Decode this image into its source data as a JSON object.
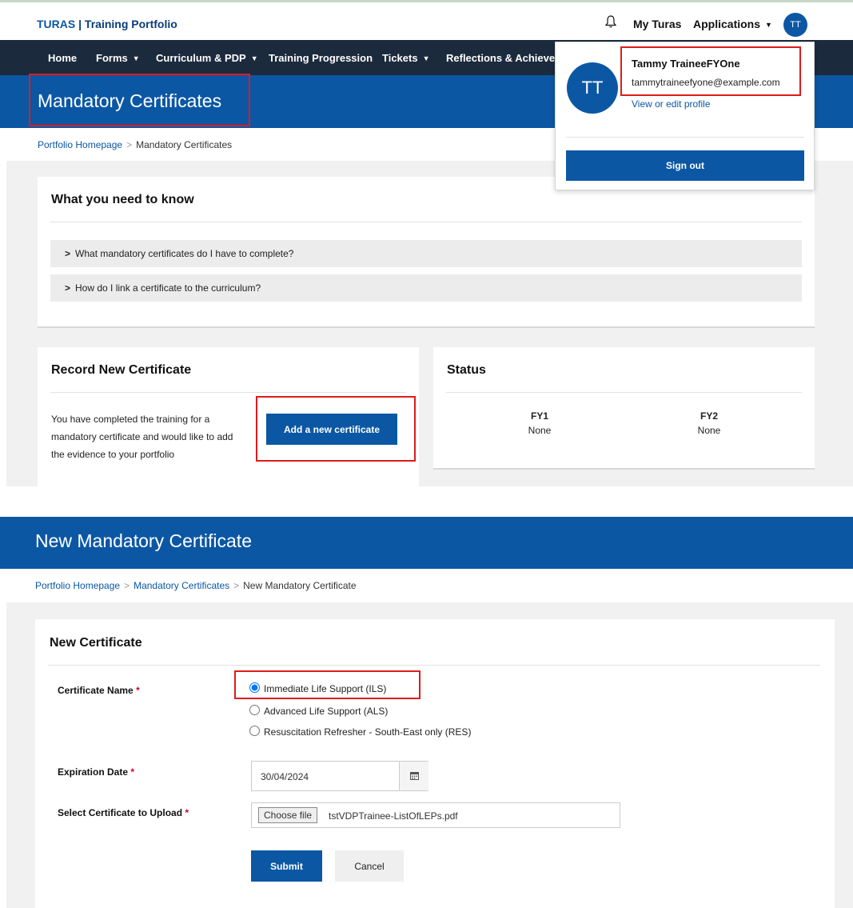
{
  "top": {
    "brand_turas": "TURAS",
    "brand_rest": " | Training Portfolio",
    "my_turas": "My Turas",
    "applications": "Applications",
    "avatar_initials": "TT",
    "nav": [
      "Home",
      "Forms",
      "Curriculum & PDP",
      "Training Progression",
      "Tickets",
      "Reflections & Achieveme"
    ],
    "page_title": "Mandatory Certificates",
    "breadcrumb": {
      "home": "Portfolio Homepage",
      "current": "Mandatory Certificates"
    },
    "need_to_know": {
      "heading": "What you need to know",
      "items": [
        "What mandatory certificates do I have to complete?",
        "How do I link a certificate to the curriculum?"
      ]
    },
    "record": {
      "heading": "Record New Certificate",
      "text_1": "You have completed the training for a",
      "text_2": "mandatory certificate and would like to add",
      "text_3": "the evidence to your portfolio",
      "button": "Add a new certificate"
    },
    "status": {
      "heading": "Status",
      "cols": [
        {
          "year": "FY1",
          "value": "None"
        },
        {
          "year": "FY2",
          "value": "None"
        }
      ]
    },
    "profile": {
      "initials": "TT",
      "name": "Tammy TraineeFYOne",
      "email": "tammytraineefyone@example.com",
      "edit_link": "View or edit profile",
      "sign_out": "Sign out"
    }
  },
  "bottom": {
    "page_title": "New Mandatory Certificate",
    "breadcrumb": {
      "home": "Portfolio Homepage",
      "middle": "Mandatory Certificates",
      "current": "New Mandatory Certificate"
    },
    "card_heading": "New Certificate",
    "certificate_label": "Certificate Name",
    "certificate_options": [
      {
        "label": "Immediate Life Support (ILS)",
        "selected": true
      },
      {
        "label": "Advanced Life Support (ALS)",
        "selected": false
      },
      {
        "label": "Resuscitation Refresher - South-East only (RES)",
        "selected": false
      }
    ],
    "expiration_label": "Expiration Date",
    "expiration_value": "30/04/2024",
    "upload_label": "Select Certificate to Upload",
    "choose_file": "Choose file",
    "file_name": "tstVDPTrainee-ListOfLEPs.pdf",
    "submit": "Submit",
    "cancel": "Cancel",
    "required_mark": "*"
  },
  "colors": {
    "brand_blue": "#0b57a4",
    "nav_dark": "#1c2a3d",
    "highlight_red": "#e01b1b"
  }
}
